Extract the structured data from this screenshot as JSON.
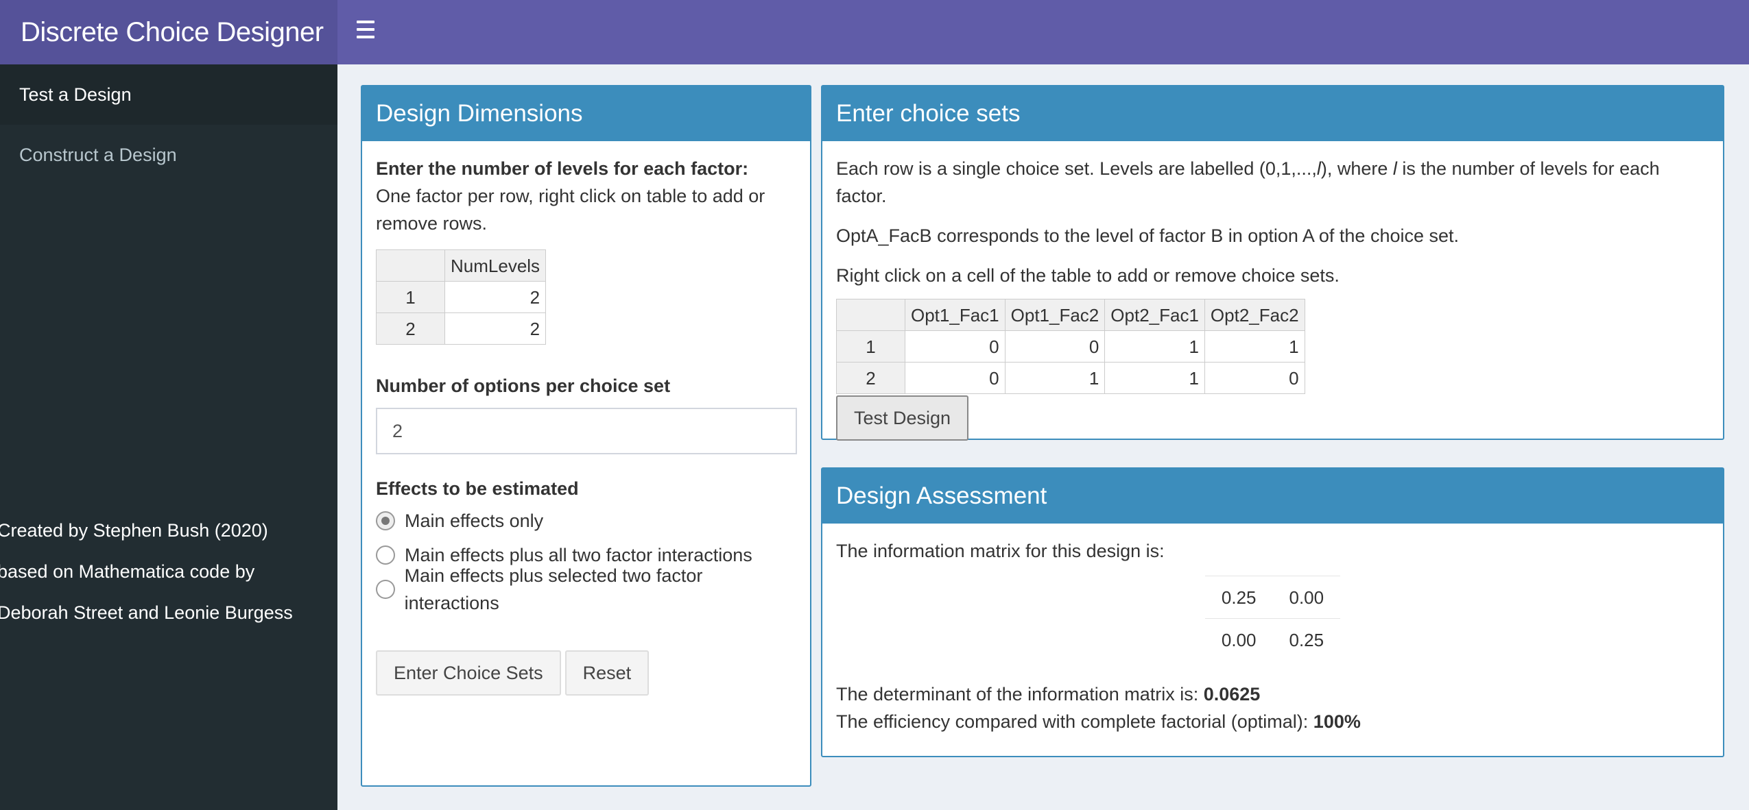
{
  "header": {
    "title": "Discrete Choice Designer"
  },
  "sidebar": {
    "items": [
      {
        "label": "Test a Design"
      },
      {
        "label": "Construct a Design"
      }
    ],
    "credits": [
      "Created by Stephen Bush (2020)",
      "based on Mathematica code by",
      "Deborah Street and Leonie Burgess"
    ]
  },
  "dimensions": {
    "title": "Design Dimensions",
    "levels_heading": "Enter the number of levels for each factor:",
    "levels_help": "One factor per row, right click on table to add or remove rows.",
    "levels_table": {
      "column": "NumLevels",
      "rows": [
        {
          "row": "1",
          "value": "2"
        },
        {
          "row": "2",
          "value": "2"
        }
      ]
    },
    "options_label": "Number of options per choice set",
    "options_value": "2",
    "effects_label": "Effects to be estimated",
    "effects": [
      {
        "label": "Main effects only"
      },
      {
        "label": "Main effects plus all two factor interactions"
      },
      {
        "label": "Main effects plus selected two factor interactions"
      }
    ],
    "enter_button": "Enter Choice Sets",
    "reset_button": "Reset"
  },
  "choice_sets": {
    "title": "Enter choice sets",
    "para1_a": "Each row is a single choice set. Levels are labelled (0,1,...,",
    "para1_l": "l",
    "para1_b": "), where ",
    "para1_l2": "l",
    "para1_c": " is the number of levels for each factor.",
    "para2": "OptA_FacB corresponds to the level of factor B in option A of the choice set.",
    "para3": "Right click on a cell of the table to add or remove choice sets.",
    "table": {
      "columns": [
        "Opt1_Fac1",
        "Opt1_Fac2",
        "Opt2_Fac1",
        "Opt2_Fac2"
      ],
      "rows": [
        {
          "row": "1",
          "cells": [
            "0",
            "0",
            "1",
            "1"
          ]
        },
        {
          "row": "2",
          "cells": [
            "0",
            "1",
            "1",
            "0"
          ]
        }
      ]
    },
    "test_button": "Test Design"
  },
  "assessment": {
    "title": "Design Assessment",
    "intro": "The information matrix for this design is:",
    "matrix": [
      [
        "0.25",
        "0.00"
      ],
      [
        "0.00",
        "0.25"
      ]
    ],
    "det_label": "The determinant of the information matrix is: ",
    "det_value": "0.0625",
    "eff_label": "The efficiency compared with complete factorial (optimal): ",
    "eff_value": "100%"
  }
}
